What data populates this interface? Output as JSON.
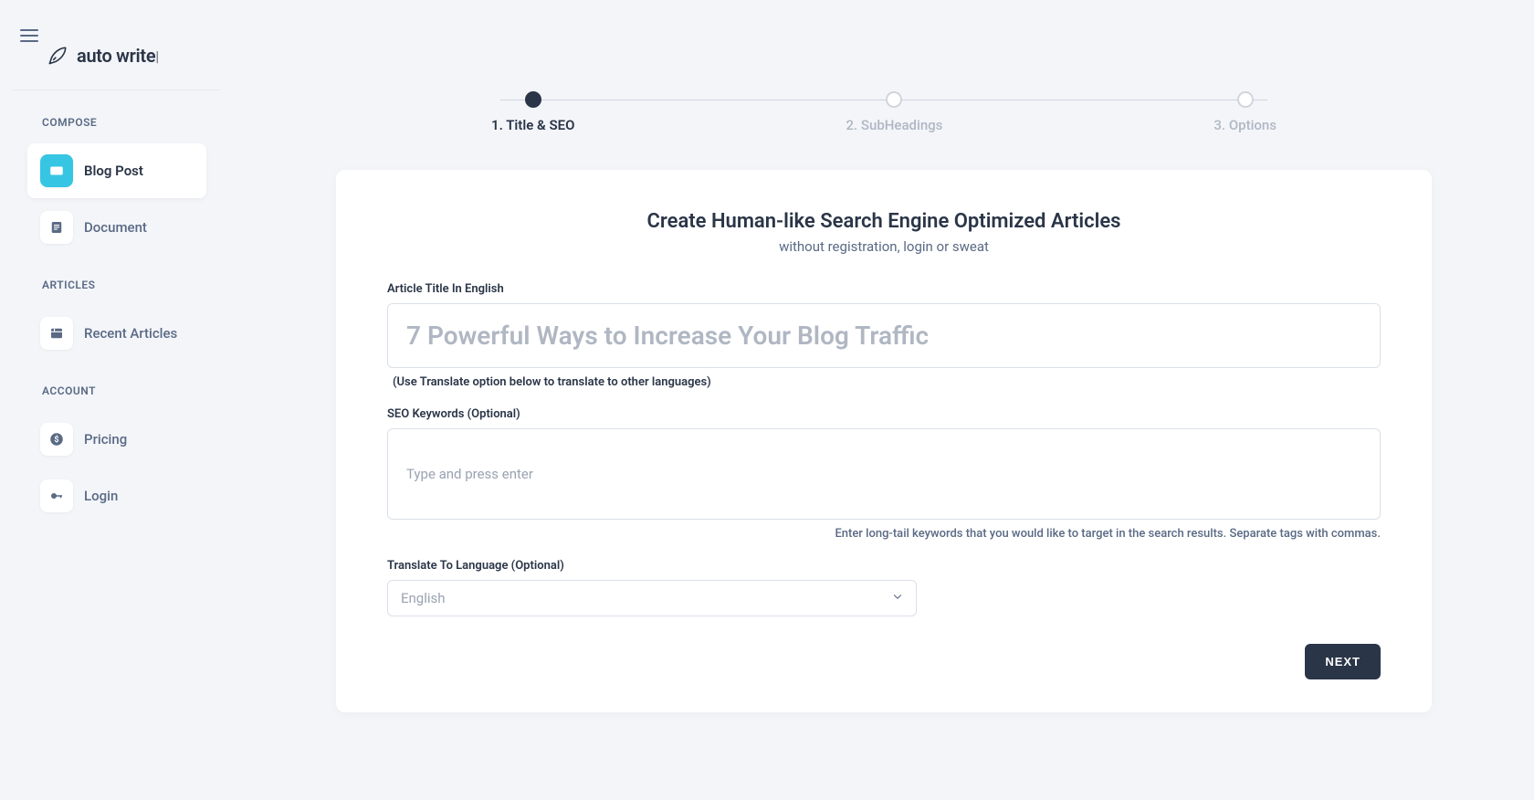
{
  "brand": {
    "name": "auto write",
    "cursor": "|"
  },
  "sidebar": {
    "sections": [
      {
        "title": "COMPOSE",
        "items": [
          {
            "label": "Blog Post",
            "icon": "post",
            "active": true
          },
          {
            "label": "Document",
            "icon": "document",
            "active": false
          }
        ]
      },
      {
        "title": "ARTICLES",
        "items": [
          {
            "label": "Recent Articles",
            "icon": "recent",
            "active": false
          }
        ]
      },
      {
        "title": "ACCOUNT",
        "items": [
          {
            "label": "Pricing",
            "icon": "dollar",
            "active": false
          },
          {
            "label": "Login",
            "icon": "key",
            "active": false
          }
        ]
      }
    ]
  },
  "stepper": {
    "steps": [
      {
        "label": "1. Title & SEO",
        "active": true
      },
      {
        "label": "2. SubHeadings",
        "active": false
      },
      {
        "label": "3. Options",
        "active": false
      }
    ]
  },
  "card": {
    "title": "Create Human-like Search Engine Optimized Articles",
    "subtitle": "without registration, login or sweat",
    "title_field": {
      "label": "Article Title In English",
      "placeholder": "7 Powerful Ways to Increase Your Blog Traffic",
      "hint": "(Use Translate option below to translate to other languages)"
    },
    "keywords_field": {
      "label": "SEO Keywords (Optional)",
      "placeholder": "Type and press enter",
      "hint": "Enter long-tail keywords that you would like to target in the search results. Separate tags with commas."
    },
    "translate_field": {
      "label": "Translate To Language (Optional)",
      "value": "English"
    },
    "next_button": "NEXT"
  }
}
